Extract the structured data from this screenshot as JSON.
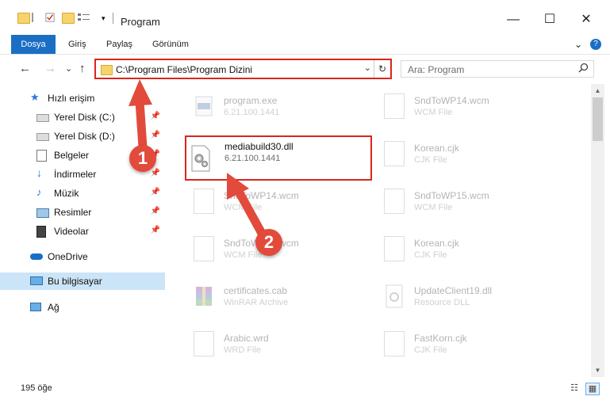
{
  "window": {
    "title": "Program",
    "minimize": "—",
    "maximize": "☐",
    "close": "✕"
  },
  "ribbon": {
    "tabs": [
      "Dosya",
      "Giriş",
      "Paylaş",
      "Görünüm"
    ],
    "expand": "⌄",
    "help": "?"
  },
  "nav": {
    "back": "←",
    "forward": "→",
    "recent": "⌄",
    "up": "↑",
    "address": "C:\\Program Files\\Program Dizini",
    "dropdown": "⌄",
    "refresh": "↻",
    "search_placeholder": "Ara: Program",
    "search_icon": "search-icon"
  },
  "sidebar": {
    "items": [
      {
        "label": "Hızlı erişim",
        "icon": "star-icon",
        "pin": ""
      },
      {
        "label": "Yerel Disk (C:)",
        "icon": "drive-icon",
        "pin": "📌"
      },
      {
        "label": "Yerel Disk (D:)",
        "icon": "drive-icon",
        "pin": "📌"
      },
      {
        "label": "Belgeler",
        "icon": "documents-icon",
        "pin": "📌"
      },
      {
        "label": "İndirmeler",
        "icon": "download-icon",
        "pin": "📌"
      },
      {
        "label": "Müzik",
        "icon": "music-icon",
        "pin": "📌"
      },
      {
        "label": "Resimler",
        "icon": "pictures-icon",
        "pin": "📌"
      },
      {
        "label": "Videolar",
        "icon": "videos-icon",
        "pin": "📌"
      },
      {
        "label": "OneDrive",
        "icon": "cloud-icon",
        "pin": ""
      },
      {
        "label": "Bu bilgisayar",
        "icon": "computer-icon",
        "pin": ""
      },
      {
        "label": "Ağ",
        "icon": "network-icon",
        "pin": ""
      }
    ]
  },
  "files": [
    {
      "name": "program.exe",
      "sub": "6.21.100.1441",
      "icon": "exe-icon"
    },
    {
      "name": "SndToWP14.wcm",
      "sub": "WCM File",
      "icon": "file-icon"
    },
    {
      "name": "mediabuild30.dll",
      "sub": "6.21.100.1441",
      "icon": "dll-gear-icon"
    },
    {
      "name": "Korean.cjk",
      "sub": "CJK File",
      "icon": "file-icon"
    },
    {
      "name": "SndToWP14.wcm",
      "sub": "WCM File",
      "icon": "file-icon"
    },
    {
      "name": "SndToWP15.wcm",
      "sub": "WCM File",
      "icon": "file-icon"
    },
    {
      "name": "SndToWP14.wcm",
      "sub": "WCM File",
      "icon": "file-icon"
    },
    {
      "name": "Korean.cjk",
      "sub": "CJK File",
      "icon": "file-icon"
    },
    {
      "name": "certificates.cab",
      "sub": "WinRAR Archive",
      "icon": "winrar-icon"
    },
    {
      "name": "UpdateClient19.dll",
      "sub": "Resource DLL",
      "icon": "dll-icon"
    },
    {
      "name": "Arabic.wrd",
      "sub": "WRD File",
      "icon": "file-icon"
    },
    {
      "name": "FastKorn.cjk",
      "sub": "CJK File",
      "icon": "file-icon"
    }
  ],
  "status": {
    "count": "195 öğe",
    "details_view": "☷",
    "icons_view": "▦"
  },
  "callouts": [
    "1",
    "2"
  ],
  "colors": {
    "accent": "#1a6fc4",
    "highlight_border": "#d9261c",
    "callout": "#e24b3b",
    "selection": "#cce4f7"
  }
}
